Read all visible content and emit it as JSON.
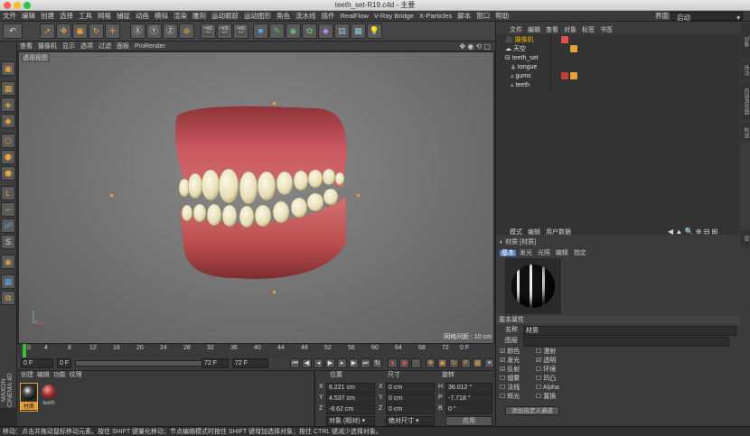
{
  "window": {
    "title": "teeth_set-R19.c4d - 主要"
  },
  "menubar": [
    "文件",
    "编辑",
    "创建",
    "选择",
    "工具",
    "网格",
    "捕捉",
    "动画",
    "模拟",
    "渲染",
    "雕刻",
    "运动跟踪",
    "运动图形",
    "角色",
    "流水线",
    "插件",
    "RealFlow",
    "V-Ray Bridge",
    "X-Particles",
    "脚本",
    "窗口",
    "帮助"
  ],
  "layout": {
    "label": "界面:",
    "value": "启动"
  },
  "viewport": {
    "menu": [
      "查看",
      "摄像机",
      "显示",
      "选项",
      "过滤",
      "面板",
      "ProRender"
    ],
    "label": "透视视图",
    "grid_info": "网格间距 : 10 cm"
  },
  "timeline": {
    "ticks": [
      "0",
      "4",
      "8",
      "12",
      "16",
      "20",
      "24",
      "28",
      "32",
      "36",
      "40",
      "44",
      "48",
      "52",
      "56",
      "60",
      "64",
      "68",
      "72"
    ],
    "end_frame": "0 F",
    "start_field": "0 F",
    "min_field": "0 F",
    "max_field": "72 F",
    "end_field": "72 F"
  },
  "materials": {
    "menu": [
      "创建",
      "编辑",
      "功能",
      "纹理"
    ],
    "items": [
      "材质",
      "teeth"
    ]
  },
  "coords": {
    "headers": [
      "位置",
      "尺寸",
      "旋转"
    ],
    "rows": [
      {
        "axis": "X",
        "pos": "6.221 cm",
        "size_axis": "X",
        "size": "0 cm",
        "rot_axis": "H",
        "rot": "36.012 °"
      },
      {
        "axis": "Y",
        "pos": "4.537 cm",
        "size_axis": "Y",
        "size": "0 cm",
        "rot_axis": "P",
        "rot": "-7.718 °"
      },
      {
        "axis": "Z",
        "pos": "-8.62 cm",
        "size_axis": "Z",
        "size": "0 cm",
        "rot_axis": "B",
        "rot": "0 °"
      }
    ],
    "mode_select": "对象 (相对)",
    "size_select": "绝对尺寸",
    "apply": "应用"
  },
  "objects": {
    "menu": [
      "文件",
      "编辑",
      "查看",
      "对象",
      "标签",
      "书签"
    ],
    "items": [
      {
        "name": "摄像机",
        "highlight": true
      },
      {
        "name": "天空",
        "highlight": false
      },
      {
        "name": "teeth_set",
        "highlight": false
      },
      {
        "name": "tongue",
        "highlight": false
      },
      {
        "name": "gums",
        "highlight": false
      },
      {
        "name": "teeth",
        "highlight": false
      }
    ]
  },
  "attributes": {
    "menu": [
      "模式",
      "编辑",
      "用户数据"
    ],
    "title": "材质 [材质]",
    "tabs": [
      "基本",
      "发光",
      "光照",
      "编辑",
      "指定"
    ],
    "section": "基本属性",
    "name_label": "名称",
    "name_value": "材质",
    "layer_label": "图层",
    "channels_left": [
      "颜色",
      "发光",
      "反射",
      "烟雾",
      "法线",
      "辉光"
    ],
    "channels_right": [
      "漫射",
      "透明",
      "环境",
      "凹凸",
      "Alpha",
      "置换"
    ],
    "button": "添加自定义通道"
  },
  "side_tabs": [
    "对象",
    "场次",
    "内容浏览器",
    "构造",
    "层"
  ],
  "status": "移动：点击并拖动鼠标移动元素。按住 SHIFT 键量化移动；节点编辑模式时按住 SHIFT 键增加选择对象；按住 CTRL 键减少选择对象。",
  "brand": "MAXON CINEMA 4D",
  "colors": {
    "accent": "#e8a23a",
    "highlight": "#f0b400"
  }
}
